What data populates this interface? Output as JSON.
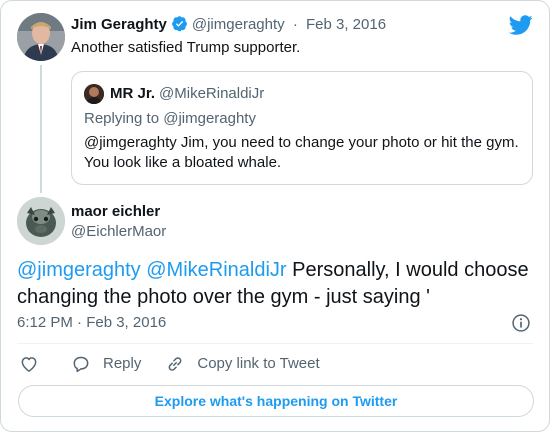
{
  "brand": {
    "logo_icon": "twitter-bird-icon",
    "accent": "#1d9bf0"
  },
  "parent_tweet": {
    "author_name": "Jim Geraghty",
    "verified_icon": "verified-badge-icon",
    "handle": "@jimgeraghty",
    "separator": "·",
    "date": "Feb 3, 2016",
    "text": "Another satisfied Trump supporter.",
    "quoted": {
      "author_name": "MR Jr.",
      "handle": "@MikeRinaldiJr",
      "replying_to": "Replying to @jimgeraghty",
      "text": "@jimgeraghty Jim, you need to change your photo or hit the gym. You look like a bloated whale."
    }
  },
  "reply_tweet": {
    "author_name": "maor eichler",
    "handle": "@EichlerMaor",
    "mention_1": "@jimgeraghty",
    "mention_2": "@MikeRinaldiJr",
    "body": " Personally, I would choose changing the photo over the gym - just saying '",
    "timestamp": "6:12 PM · Feb 3, 2016"
  },
  "actions": {
    "like_icon": "heart-icon",
    "reply_icon": "reply-bubble-icon",
    "reply_label": "Reply",
    "copy_icon": "link-icon",
    "copy_label": "Copy link to Tweet",
    "info_icon": "info-icon"
  },
  "explore_label": "Explore what's happening on Twitter"
}
